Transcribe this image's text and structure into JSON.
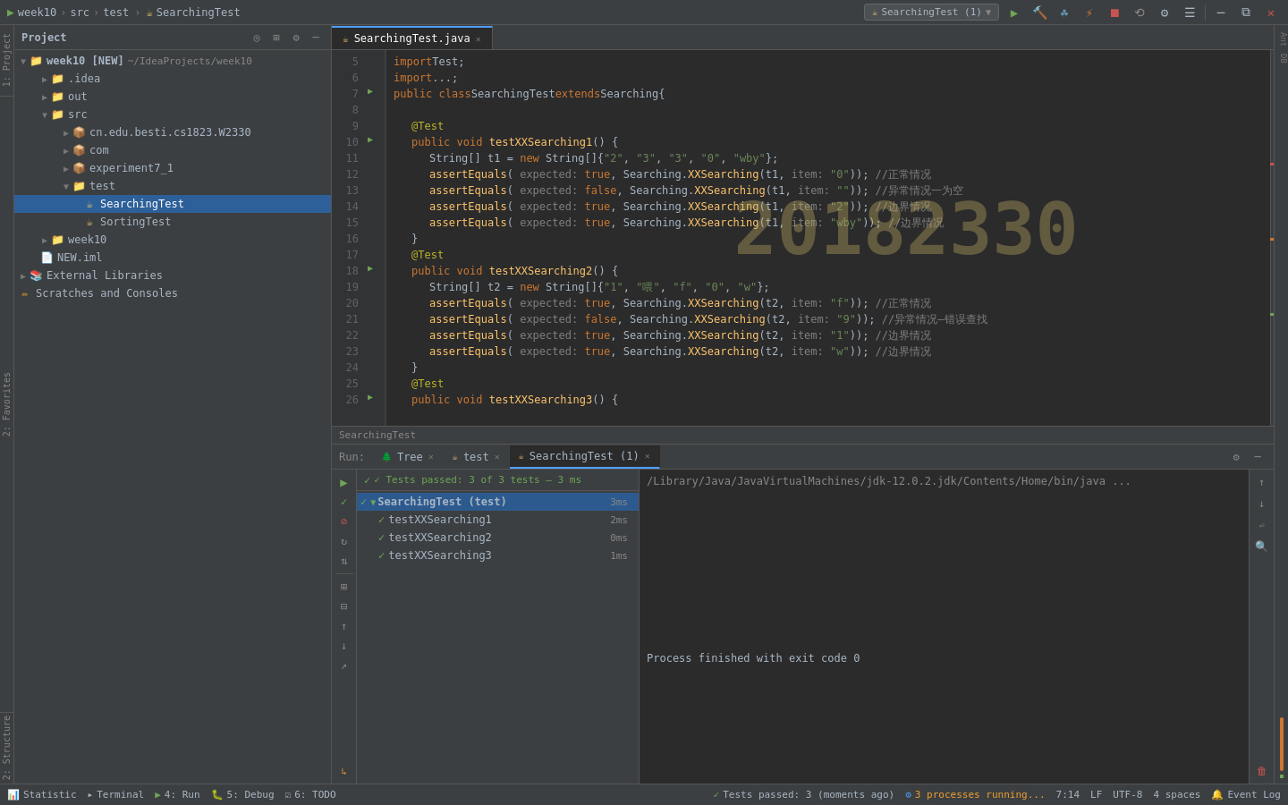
{
  "titleBar": {
    "breadcrumb": [
      "week10",
      "src",
      "test"
    ],
    "activeFile": "SearchingTest",
    "runConfig": "SearchingTest (1)",
    "buttons": {
      "run": "▶",
      "build": "🔨",
      "debug": "🐛",
      "coverage": "📊",
      "stop": "⏹",
      "profile": "⚡",
      "settings": "⚙",
      "minimize": "─",
      "maximize": "□",
      "restore": "⧉",
      "close": "✕"
    }
  },
  "projectPanel": {
    "title": "Project",
    "root": "week10 [NEW]",
    "rootPath": "~/IdeaProjects/week10",
    "items": [
      {
        "id": "idea",
        "label": ".idea",
        "indent": 1,
        "type": "folder",
        "expanded": false
      },
      {
        "id": "out",
        "label": "out",
        "indent": 1,
        "type": "folder",
        "expanded": false
      },
      {
        "id": "src",
        "label": "src",
        "indent": 1,
        "type": "folder",
        "expanded": true
      },
      {
        "id": "cn",
        "label": "cn.edu.besti.cs1823.W2330",
        "indent": 2,
        "type": "package",
        "expanded": false
      },
      {
        "id": "com",
        "label": "com",
        "indent": 2,
        "type": "folder",
        "expanded": false
      },
      {
        "id": "exp",
        "label": "experiment7_1",
        "indent": 2,
        "type": "folder",
        "expanded": false
      },
      {
        "id": "test",
        "label": "test",
        "indent": 2,
        "type": "folder",
        "expanded": true
      },
      {
        "id": "searchingtest",
        "label": "SearchingTest",
        "indent": 3,
        "type": "javatest",
        "selected": true
      },
      {
        "id": "sortingtest",
        "label": "SortingTest",
        "indent": 3,
        "type": "javatest"
      },
      {
        "id": "week10",
        "label": "week10",
        "indent": 1,
        "type": "folder",
        "expanded": false
      },
      {
        "id": "new",
        "label": "NEW.iml",
        "indent": 1,
        "type": "iml"
      },
      {
        "id": "extlib",
        "label": "External Libraries",
        "indent": 0,
        "type": "extlib",
        "expanded": false
      },
      {
        "id": "scratches",
        "label": "Scratches and Consoles",
        "indent": 0,
        "type": "scratches",
        "expanded": false
      }
    ]
  },
  "editor": {
    "tab": "SearchingTest.java",
    "lines": [
      {
        "num": 5,
        "content": "import Test;"
      },
      {
        "num": 6,
        "content": "import ...;"
      },
      {
        "num": 7,
        "content": "public class SearchingTest extends Searching {",
        "hasGutter": true
      },
      {
        "num": 8,
        "content": ""
      },
      {
        "num": 9,
        "content": "    @Test"
      },
      {
        "num": 10,
        "content": "    public void testXXSearching1() {",
        "hasGutter": true
      },
      {
        "num": 11,
        "content": "        String[] t1 = new String[]{\"2\", \"3\", \"3\", \"0\", \"wby\"};"
      },
      {
        "num": 12,
        "content": "        assertEquals( expected: true, Searching.XXSearching(t1,  item: \"0\"));    //正常情况"
      },
      {
        "num": 13,
        "content": "        assertEquals( expected: false, Searching.XXSearching(t1,  item: \"\"));   //异常情况一为空"
      },
      {
        "num": 14,
        "content": "        assertEquals( expected: true, Searching.XXSearching(t1,  item: \"2\"));  //边界情况"
      },
      {
        "num": 15,
        "content": "        assertEquals( expected: true, Searching.XXSearching(t1,  item: \"wby\")); //边界情况"
      },
      {
        "num": 16,
        "content": "    }"
      },
      {
        "num": 17,
        "content": "    @Test"
      },
      {
        "num": 18,
        "content": "    public void testXXSearching2() {",
        "hasGutter": true
      },
      {
        "num": 19,
        "content": "        String[] t2 = new String[]{\"1\", \"喂\", \"f\", \"0\", \"w\"};"
      },
      {
        "num": 20,
        "content": "        assertEquals( expected: true, Searching.XXSearching(t2,  item: \"f\"));   //正常情况"
      },
      {
        "num": 21,
        "content": "        assertEquals( expected: false, Searching.XXSearching(t2,  item: \"9\"));  //异常情况—错误查找"
      },
      {
        "num": 22,
        "content": "        assertEquals( expected: true, Searching.XXSearching(t2,  item: \"1\"));  //边界情况"
      },
      {
        "num": 23,
        "content": "        assertEquals( expected: true, Searching.XXSearching(t2,  item: \"w\"));  //边界情况"
      },
      {
        "num": 24,
        "content": "    }"
      },
      {
        "num": 25,
        "content": "    @Test"
      },
      {
        "num": 26,
        "content": "    public void testXXSearching3() {",
        "hasGutter": true
      }
    ],
    "footerLabel": "SearchingTest",
    "watermark": "20182330"
  },
  "runPanel": {
    "runLabel": "Run:",
    "tabs": [
      {
        "label": "Tree",
        "active": false,
        "closable": true
      },
      {
        "label": "test",
        "active": false,
        "closable": true
      },
      {
        "label": "SearchingTest (1)",
        "active": true,
        "closable": true
      }
    ],
    "testStatus": "✓ Tests passed: 3 of 3 tests – 3 ms",
    "consolePath": "/Library/Java/JavaVirtualMachines/jdk-12.0.2.jdk/Contents/Home/bin/java ...",
    "testTree": [
      {
        "id": "root",
        "label": "SearchingTest (test)",
        "indent": 0,
        "time": "3ms",
        "status": "pass",
        "bold": true,
        "selected": true
      },
      {
        "id": "t1",
        "label": "testXXSearching1",
        "indent": 1,
        "time": "2ms",
        "status": "pass"
      },
      {
        "id": "t2",
        "label": "testXXSearching2",
        "indent": 1,
        "time": "0ms",
        "status": "pass"
      },
      {
        "id": "t3",
        "label": "testXXSearching3",
        "indent": 1,
        "time": "1ms",
        "status": "pass"
      }
    ],
    "consoleOutput": "Process finished with exit code 0"
  },
  "statusBar": {
    "statistic": "Statistic",
    "terminal": "Terminal",
    "run": "4: Run",
    "debug": "5: Debug",
    "todo": "6: TODO",
    "eventLog": "Event Log",
    "processRunning": "3 processes running...",
    "time": "7:14",
    "lf": "LF",
    "encoding": "UTF-8",
    "spaces": "4 spaces",
    "testsPassed": "Tests passed: 3 (moments ago)"
  }
}
